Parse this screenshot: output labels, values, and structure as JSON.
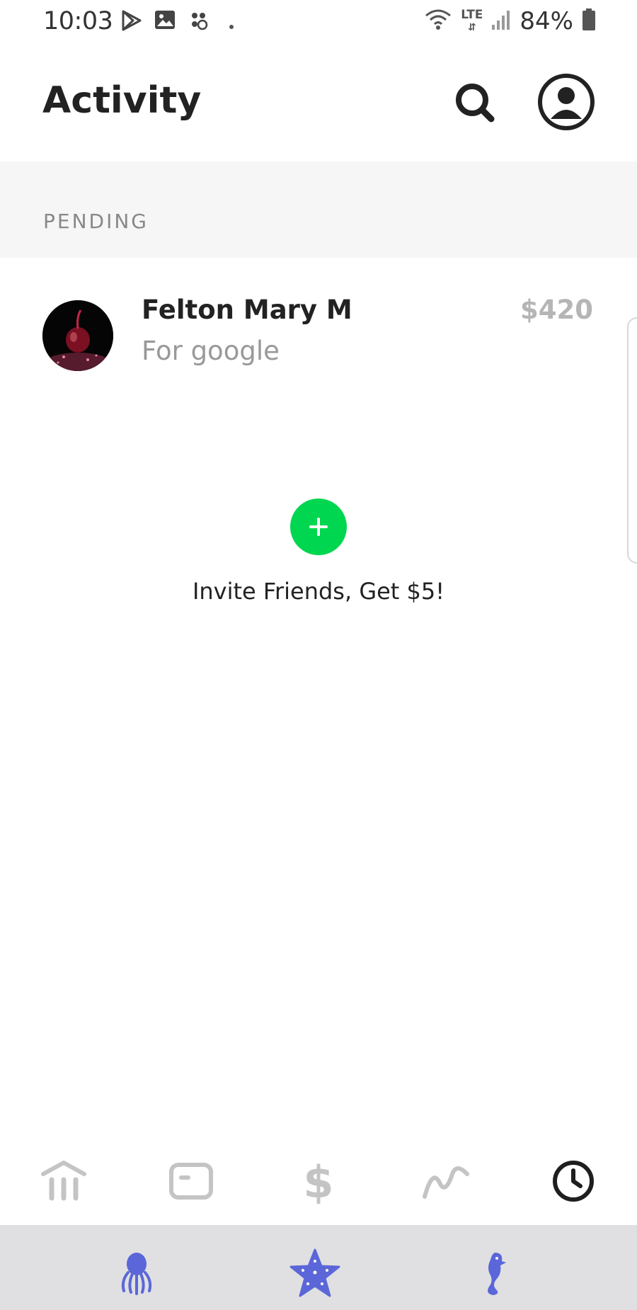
{
  "status_bar": {
    "time": "10:03",
    "network": "LTE",
    "battery": "84%",
    "icons": [
      "play-store-icon",
      "gallery-icon",
      "slack-icon",
      "dot-icon",
      "wifi-icon",
      "signal-icon",
      "battery-icon"
    ]
  },
  "header": {
    "title": "Activity",
    "search_icon": "search-icon",
    "profile_icon": "profile-icon"
  },
  "pending": {
    "label": "PENDING",
    "items": [
      {
        "name": "Felton Mary M",
        "note": "For google",
        "amount": "$420"
      }
    ]
  },
  "invite": {
    "label": "Invite Friends, Get $5!",
    "accent": "#00d64f"
  },
  "bottom_nav": {
    "items": [
      "bank-icon",
      "card-icon",
      "dollar-icon",
      "investing-icon",
      "activity-clock-icon"
    ],
    "active": "activity-clock-icon",
    "inactive_color": "#c4c4c4",
    "active_color": "#1f1f1f"
  },
  "dock": {
    "items": [
      "octopus-icon",
      "starfish-icon",
      "seahorse-icon"
    ],
    "color": "#5b67d8",
    "background": "#e0e0e2"
  }
}
